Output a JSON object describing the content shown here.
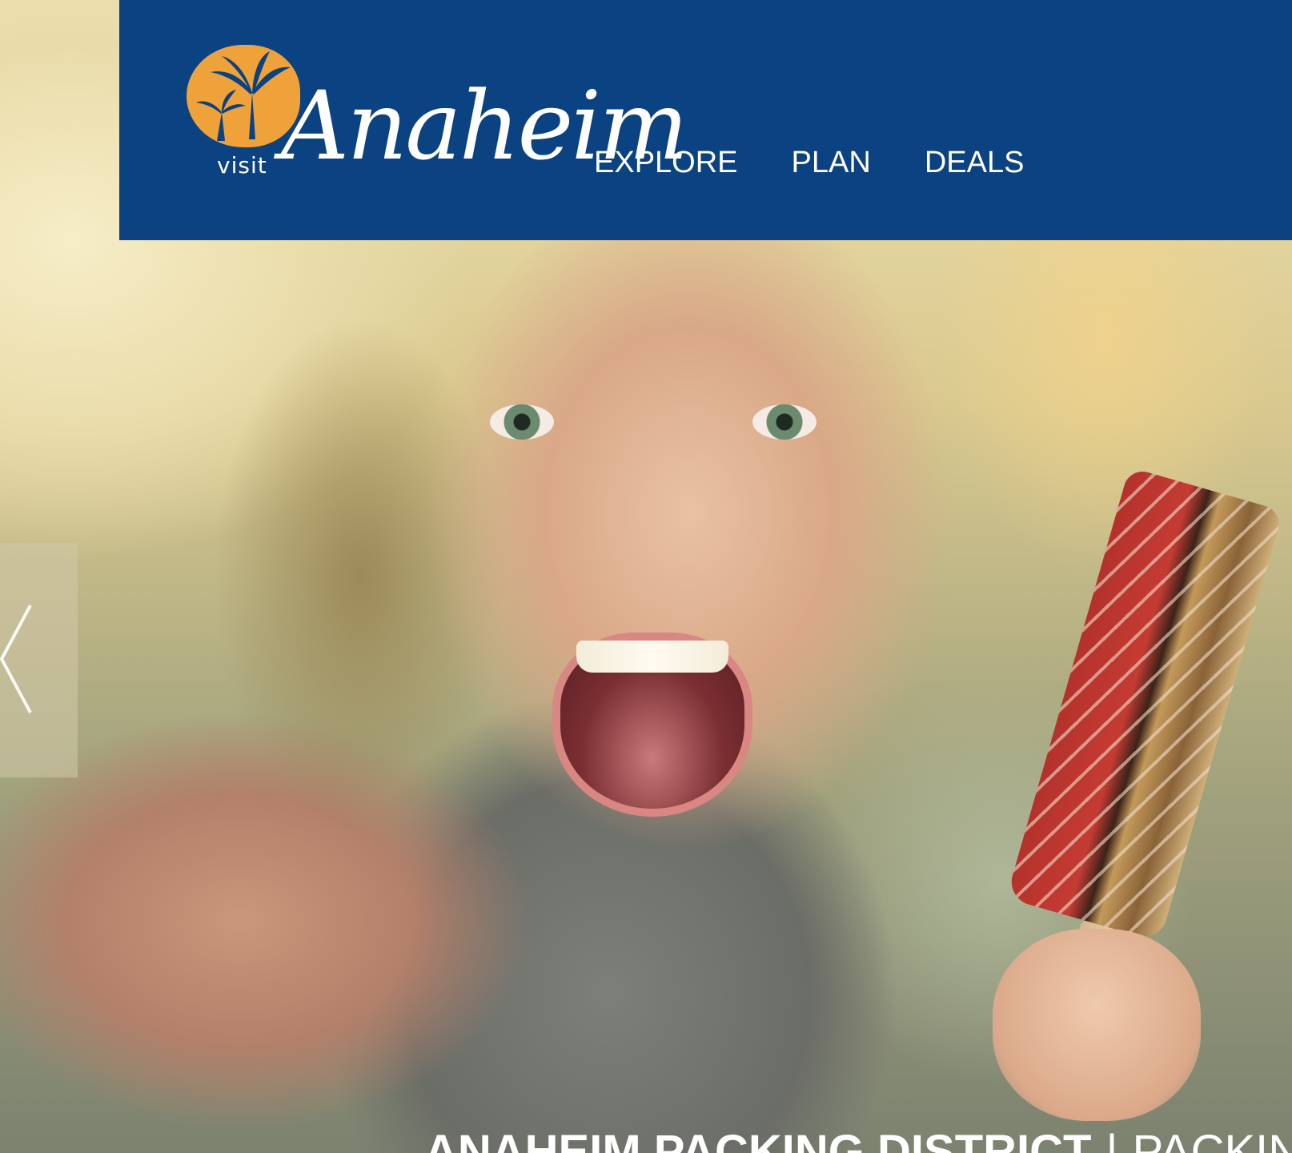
{
  "colors": {
    "header_bg": "#0b4281",
    "logo_orange": "#f0a23a",
    "text": "#ffffff"
  },
  "logo": {
    "visit": "visit",
    "name": "Anaheim"
  },
  "nav": {
    "items": [
      {
        "label": "EXPLORE"
      },
      {
        "label": "PLAN"
      },
      {
        "label": "DEALS"
      }
    ]
  },
  "slider": {
    "prev_icon": "chevron-left-icon"
  },
  "caption": {
    "title": "ANAHEIM PACKING DISTRICT",
    "separator": "|",
    "subtitle": "PACKING H"
  }
}
